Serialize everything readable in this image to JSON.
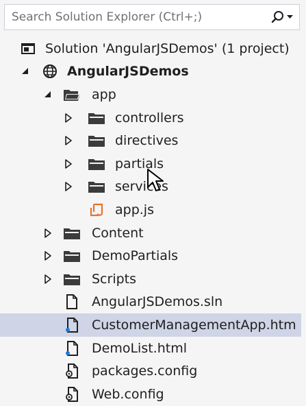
{
  "search": {
    "placeholder": "Search Solution Explorer (Ctrl+;)",
    "icon": "search-icon"
  },
  "tree": [
    {
      "label": "Solution 'AngularJSDemos' (1 project)",
      "icon": "solution-icon",
      "depth": 0,
      "arrow": "none",
      "bold": false,
      "selected": false
    },
    {
      "label": "AngularJSDemos",
      "icon": "web-project-icon",
      "depth": 1,
      "arrow": "expanded",
      "bold": true,
      "selected": false
    },
    {
      "label": "app",
      "icon": "folder-open-icon",
      "depth": 2,
      "arrow": "expanded",
      "bold": false,
      "selected": false
    },
    {
      "label": "controllers",
      "icon": "folder-icon",
      "depth": 3,
      "arrow": "collapsed",
      "bold": false,
      "selected": false
    },
    {
      "label": "directives",
      "icon": "folder-icon",
      "depth": 3,
      "arrow": "collapsed",
      "bold": false,
      "selected": false
    },
    {
      "label": "partials",
      "icon": "folder-icon",
      "depth": 3,
      "arrow": "collapsed",
      "bold": false,
      "selected": false
    },
    {
      "label": "services",
      "icon": "folder-icon",
      "depth": 3,
      "arrow": "collapsed",
      "bold": false,
      "selected": false
    },
    {
      "label": "app.js",
      "icon": "js-file-icon",
      "depth": 3,
      "arrow": "none",
      "bold": false,
      "selected": false
    },
    {
      "label": "Content",
      "icon": "folder-icon",
      "depth": 2,
      "arrow": "collapsed",
      "bold": false,
      "selected": false
    },
    {
      "label": "DemoPartials",
      "icon": "folder-icon",
      "depth": 2,
      "arrow": "collapsed",
      "bold": false,
      "selected": false
    },
    {
      "label": "Scripts",
      "icon": "folder-icon",
      "depth": 2,
      "arrow": "collapsed",
      "bold": false,
      "selected": false
    },
    {
      "label": "AngularJSDemos.sln",
      "icon": "file-icon",
      "depth": 2,
      "arrow": "none",
      "bold": false,
      "selected": false
    },
    {
      "label": "CustomerManagementApp.htm",
      "icon": "html-file-icon",
      "depth": 2,
      "arrow": "none",
      "bold": false,
      "selected": true
    },
    {
      "label": "DemoList.html",
      "icon": "html-file-icon",
      "depth": 2,
      "arrow": "none",
      "bold": false,
      "selected": false
    },
    {
      "label": "packages.config",
      "icon": "config-file-icon",
      "depth": 2,
      "arrow": "none",
      "bold": false,
      "selected": false
    },
    {
      "label": "Web.config",
      "icon": "config-file-icon",
      "depth": 2,
      "arrow": "none",
      "bold": false,
      "selected": false
    }
  ],
  "colors": {
    "selection": "#cfd4e6",
    "js_icon": "#e8722c",
    "html_badge": "#1c7bd4",
    "folder": "#3b3b3b"
  }
}
